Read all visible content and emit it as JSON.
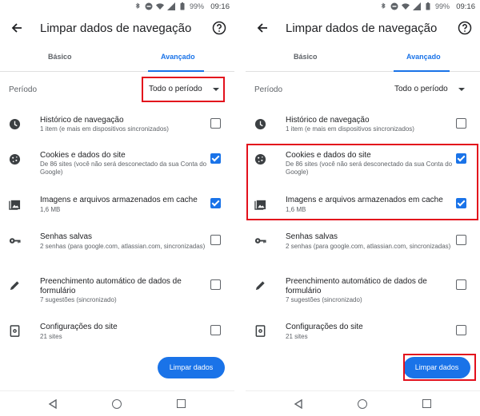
{
  "status_bar": {
    "battery": "99%",
    "time": "09:16"
  },
  "appbar": {
    "title": "Limpar dados de navegação"
  },
  "tabs": {
    "basic": "Básico",
    "advanced": "Avançado"
  },
  "period": {
    "label": "Período",
    "value": "Todo o período"
  },
  "rows": [
    {
      "title": "Histórico de navegação",
      "subtitle": "1 item (e mais em dispositivos sincronizados)",
      "checked": false,
      "icon": "history-icon"
    },
    {
      "title": "Cookies e dados do site",
      "subtitle": "De 86 sites (você não será desconectado da sua Conta do Google)",
      "checked": true,
      "icon": "cookie-icon"
    },
    {
      "title": "Imagens e arquivos armazenados em cache",
      "subtitle": "1,6 MB",
      "checked": true,
      "icon": "image-icon"
    },
    {
      "title": "Senhas salvas",
      "subtitle": "2 senhas (para google.com, atlassian.com, sincronizadas)",
      "checked": false,
      "icon": "key-icon"
    },
    {
      "title": "Preenchimento automático de dados de formulário",
      "subtitle": "7 sugestões (sincronizado)",
      "checked": false,
      "icon": "pencil-icon"
    },
    {
      "title": "Configurações do site",
      "subtitle": "21 sites",
      "checked": false,
      "icon": "site-settings-icon"
    }
  ],
  "clear_button": {
    "label": "Limpar dados"
  },
  "colors": {
    "accent": "#1a73e8",
    "highlight": "#e3101c"
  }
}
